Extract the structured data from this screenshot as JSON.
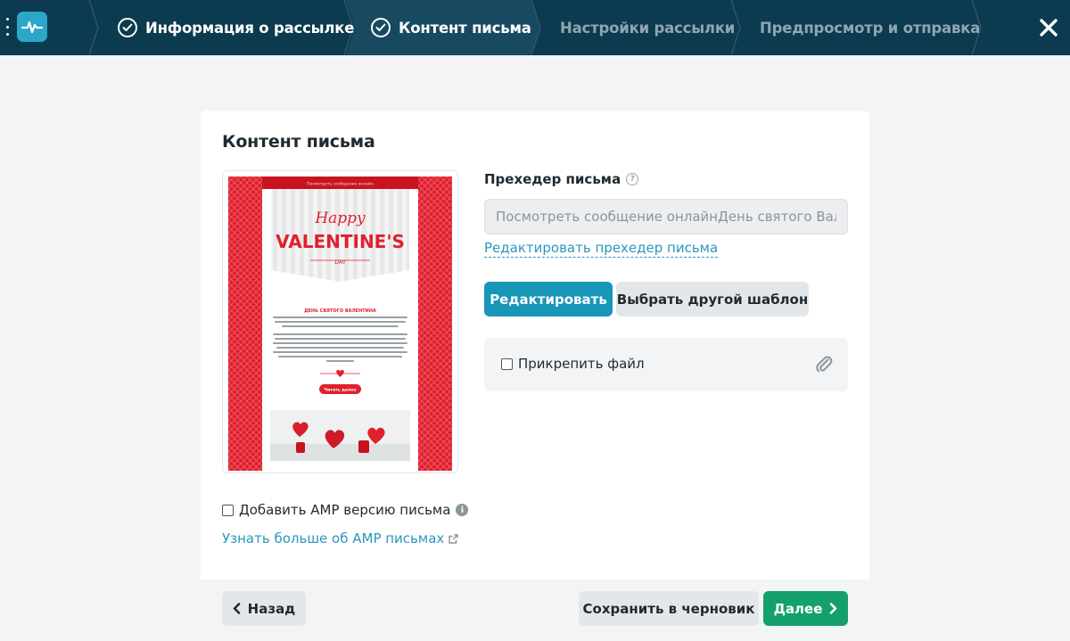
{
  "header": {
    "steps": [
      {
        "label": "Информация о рассылке",
        "state": "done"
      },
      {
        "label": "Контент письма",
        "state": "current"
      },
      {
        "label": "Настройки рассылки",
        "state": "todo"
      },
      {
        "label": "Предпросмотр и отправка",
        "state": "todo"
      }
    ],
    "colors": {
      "bar": "#0c3a4e",
      "active_step": "#174a60",
      "logo": "#2aa7c9"
    }
  },
  "content": {
    "title": "Контент письма",
    "preview": {
      "top_link": "Посмотреть сообщение онлайн",
      "hero_script": "Happy",
      "hero_main": "VALENTINE'S",
      "hero_sub": "DAY",
      "heading": "ДЕНЬ СВЯТОГО ВАЛЕНТИНА",
      "read_more": "Читать далее"
    },
    "preheader": {
      "label": "Прехедер письма",
      "value": "Посмотреть сообщение онлайнДень святого Вале",
      "edit_link": "Редактировать прехедер письма"
    },
    "buttons": {
      "edit": "Редактировать",
      "choose_template": "Выбрать другой шаблон"
    },
    "attach": {
      "label": "Прикрепить файл",
      "checked": false
    },
    "amp": {
      "label": "Добавить AMP версию письма",
      "checked": false,
      "learn_more": "Узнать больше об AMP письмах"
    }
  },
  "footer": {
    "back": "Назад",
    "save_draft": "Сохранить в черновик",
    "next": "Далее"
  },
  "colors": {
    "primary": "#1896b8",
    "success": "#14a06c",
    "link": "#2b97bd",
    "preview_red": "#e0202f"
  }
}
